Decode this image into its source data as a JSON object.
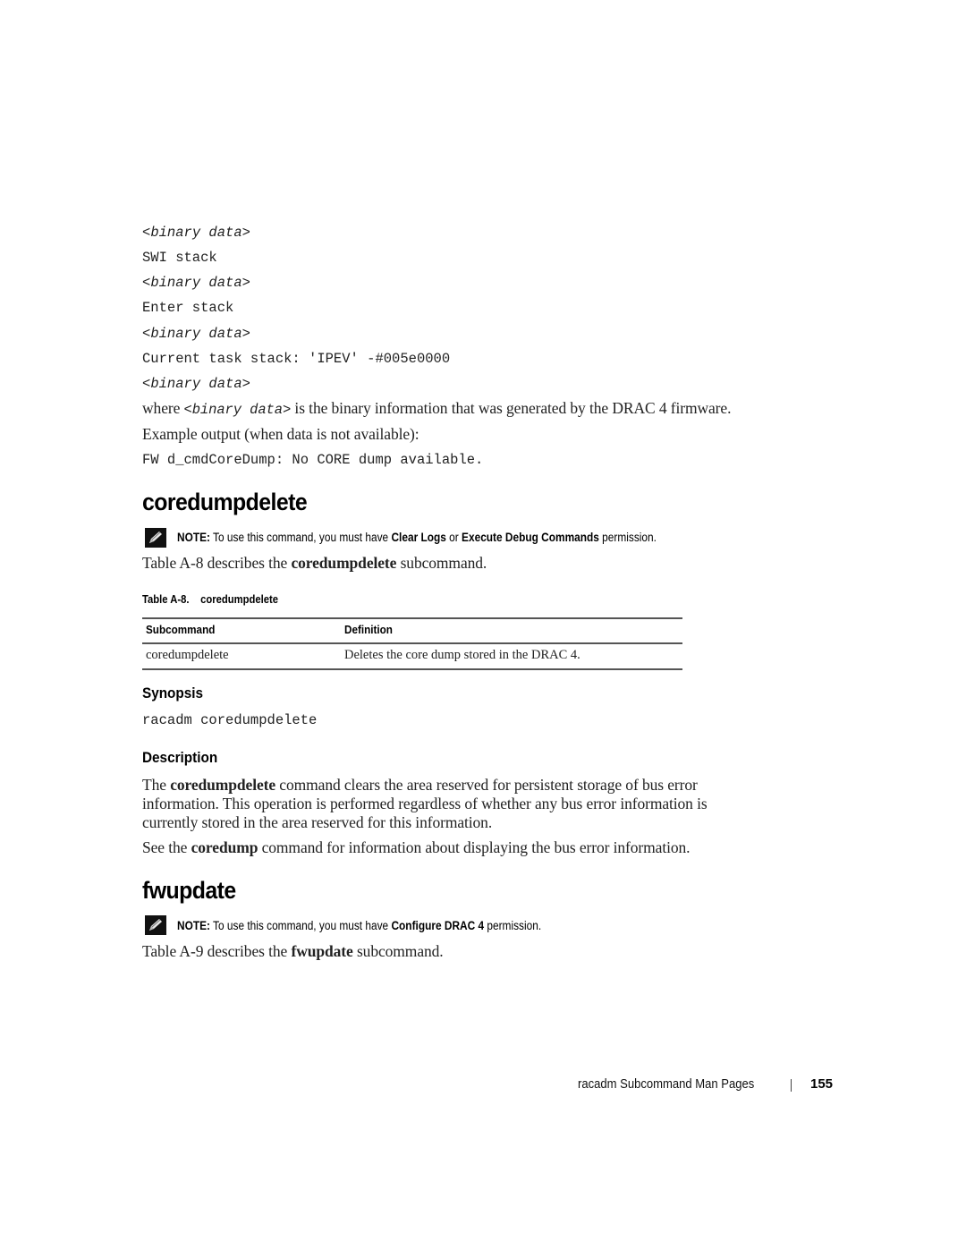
{
  "code_block": {
    "lines": [
      {
        "italic": true,
        "text": "binary data",
        "wrap_lt": "<",
        "wrap_gt": ">"
      },
      {
        "italic": false,
        "text": "SWI stack"
      },
      {
        "italic": true,
        "text": "binary data",
        "wrap_lt": "<",
        "wrap_gt": ">"
      },
      {
        "italic": false,
        "text": "Enter stack"
      },
      {
        "italic": true,
        "text": "binary data",
        "wrap_lt": "<",
        "wrap_gt": ">"
      },
      {
        "italic": false,
        "text": "Current task stack: 'IPEV' -#005e0000"
      },
      {
        "italic": true,
        "text": "binary data",
        "wrap_lt": "<",
        "wrap_gt": ">"
      }
    ]
  },
  "where_line": {
    "prefix": "where ",
    "code": "binary data",
    "lt": "<",
    "gt": ">",
    "suffix": " is the binary information that was generated by the DRAC 4 firmware."
  },
  "example_line": "Example output (when data is not available):",
  "example_code": "FW d_cmdCoreDump: No CORE dump available.",
  "section_coredumpdelete": {
    "title": "coredumpdelete",
    "note": {
      "label": "NOTE:",
      "text_before": " To use this command, you must have ",
      "bold1": "Clear Logs",
      "text_mid": " or ",
      "bold2": "Execute Debug Commands",
      "text_after": " permission."
    },
    "intro": {
      "before": "Table A-8 describes the ",
      "bold": "coredumpdelete",
      "after": " subcommand."
    },
    "table": {
      "caption_num": "Table A-8.",
      "caption_title": "coredumpdelete",
      "headers": [
        "Subcommand",
        "Definition"
      ],
      "rows": [
        [
          "coredumpdelete",
          "Deletes the core dump stored in the DRAC 4."
        ]
      ]
    },
    "synopsis_heading": "Synopsis",
    "synopsis_code": "racadm coredumpdelete",
    "description_heading": "Description",
    "description_p1": {
      "before": "The ",
      "bold": "coredumpdelete",
      "line1_after": " command clears the area reserved for persistent storage of bus error",
      "line2": "information. This operation is performed regardless of whether any bus error information is",
      "line3": "currently stored in the area reserved for this information."
    },
    "description_p2": {
      "before": "See the ",
      "bold": "coredump",
      "after": " command for information about displaying the bus error information."
    }
  },
  "section_fwupdate": {
    "title": "fwupdate",
    "note": {
      "label": "NOTE:",
      "text_before": " To use this command, you must have ",
      "bold1": "Configure DRAC 4",
      "text_after": " permission."
    },
    "intro": {
      "before": "Table A-9 describes the ",
      "bold": "fwupdate",
      "after": " subcommand."
    }
  },
  "footer": {
    "chapter": "racadm Subcommand Man Pages",
    "page_number": "155"
  }
}
